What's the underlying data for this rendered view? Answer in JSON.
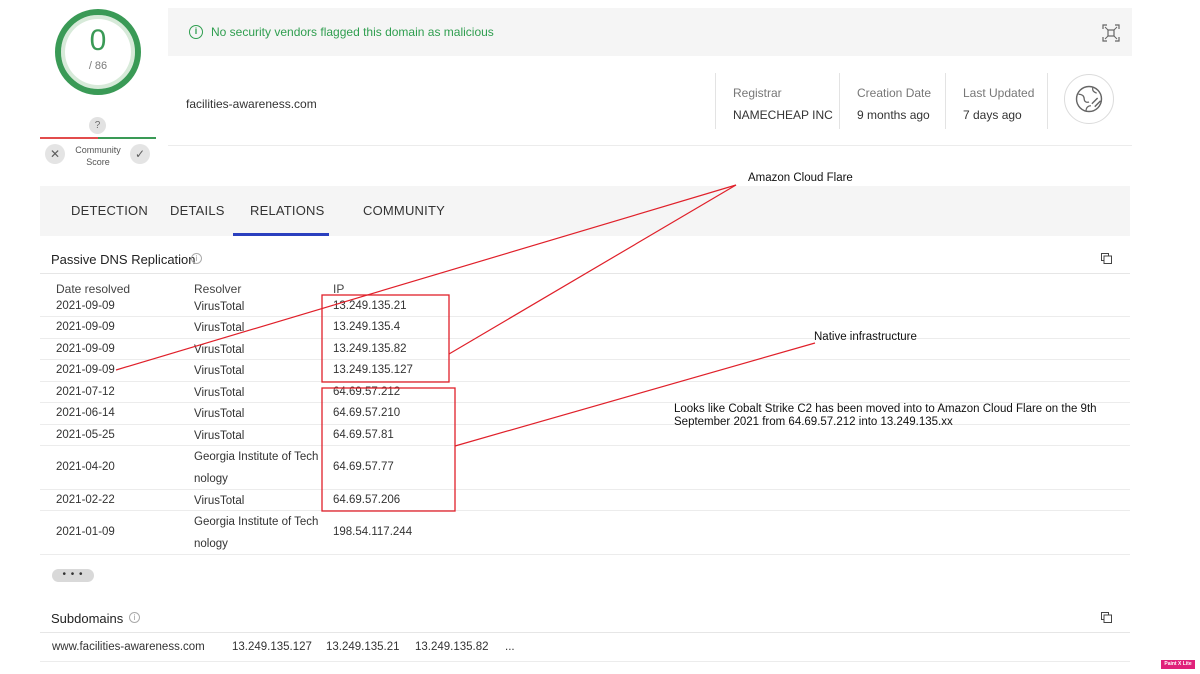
{
  "score": {
    "value": "0",
    "total": "/ 86"
  },
  "community": {
    "label": "Community Score",
    "question": "?"
  },
  "banner": {
    "text": "No security vendors flagged this domain as malicious"
  },
  "domain": "facilities-awareness.com",
  "meta": [
    {
      "label": "Registrar",
      "value": "NAMECHEAP INC"
    },
    {
      "label": "Creation Date",
      "value": "9 months ago"
    },
    {
      "label": "Last Updated",
      "value": "7 days ago"
    }
  ],
  "tabs": [
    "DETECTION",
    "DETAILS",
    "RELATIONS",
    "COMMUNITY"
  ],
  "active_tab": "RELATIONS",
  "passive_dns": {
    "title": "Passive DNS Replication",
    "columns": [
      "Date resolved",
      "Resolver",
      "IP"
    ],
    "rows": [
      {
        "date": "2021-09-09",
        "resolver": "VirusTotal",
        "ip": "13.249.135.21"
      },
      {
        "date": "2021-09-09",
        "resolver": "VirusTotal",
        "ip": "13.249.135.4"
      },
      {
        "date": "2021-09-09",
        "resolver": "VirusTotal",
        "ip": "13.249.135.82"
      },
      {
        "date": "2021-09-09",
        "resolver": "VirusTotal",
        "ip": "13.249.135.127"
      },
      {
        "date": "2021-07-12",
        "resolver": "VirusTotal",
        "ip": "64.69.57.212"
      },
      {
        "date": "2021-06-14",
        "resolver": "VirusTotal",
        "ip": "64.69.57.210"
      },
      {
        "date": "2021-05-25",
        "resolver": "VirusTotal",
        "ip": "64.69.57.81"
      },
      {
        "date": "2021-04-20",
        "resolver": "Georgia Institute of Tech nology",
        "ip": "64.69.57.77"
      },
      {
        "date": "2021-02-22",
        "resolver": "VirusTotal",
        "ip": "64.69.57.206"
      },
      {
        "date": "2021-01-09",
        "resolver": "Georgia Institute of Tech nology",
        "ip": "198.54.117.244"
      }
    ],
    "more": "• • •"
  },
  "subdomains": {
    "title": "Subdomains",
    "items": [
      "www.facilities-awareness.com",
      "13.249.135.127",
      "13.249.135.21",
      "13.249.135.82",
      "..."
    ]
  },
  "annotations": {
    "cloudflare": "Amazon Cloud Flare",
    "native": "Native infrastructure",
    "note": "Looks like Cobalt Strike C2 has been moved into to Amazon Cloud Flare on the 9th September 2021  from 64.69.57.212 into 13.249.135.xx",
    "color": "#e0202a"
  },
  "badge": "Paint X Lite",
  "colors": {
    "clean": "#3a9a56",
    "tab_active": "#2a3fbf"
  }
}
